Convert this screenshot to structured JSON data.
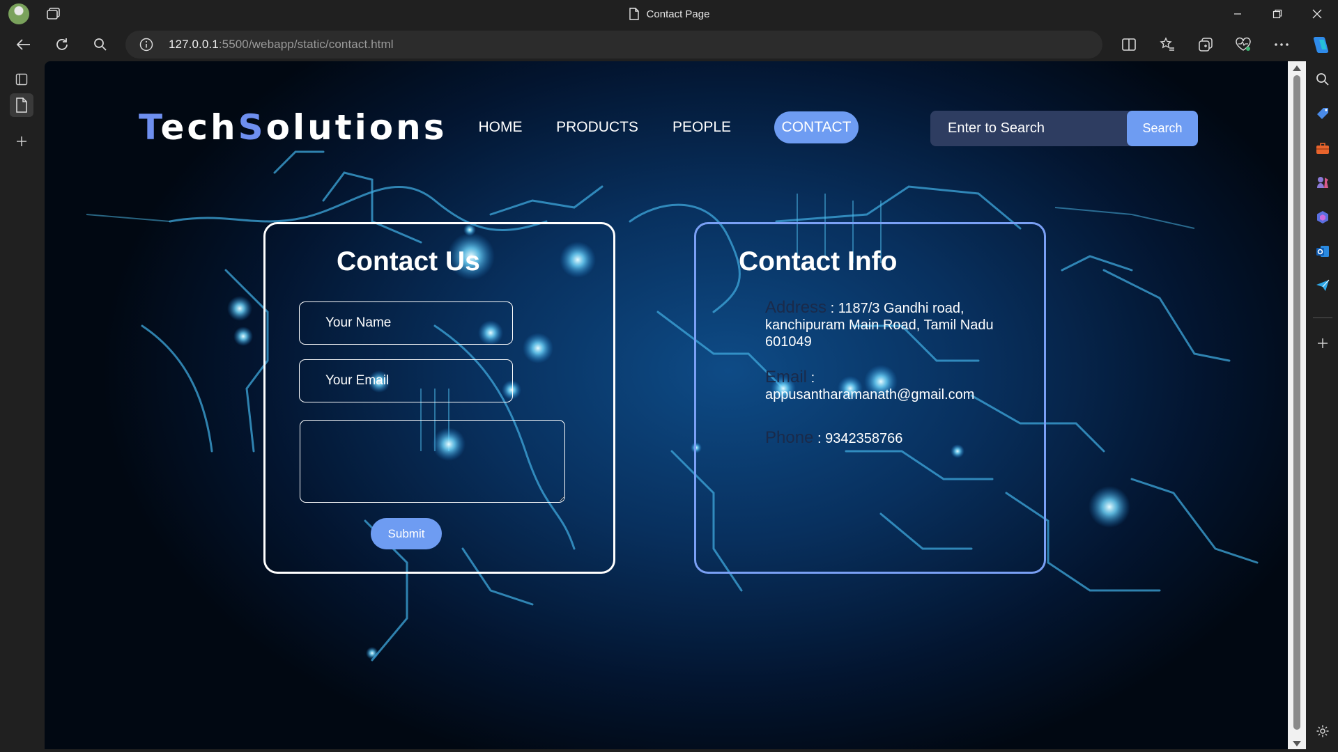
{
  "browser": {
    "tab_title": "Contact Page",
    "url_host": "127.0.0.1",
    "url_path": ":5500/webapp/static/contact.html"
  },
  "header": {
    "logo_part1": "T",
    "logo_part2": "ech",
    "logo_part3": "S",
    "logo_part4": "olutions",
    "nav": [
      {
        "label": "HOME"
      },
      {
        "label": "PRODUCTS"
      },
      {
        "label": "PEOPLE"
      },
      {
        "label": "CONTACT"
      }
    ],
    "search_placeholder": "Enter to Search",
    "search_button": "Search"
  },
  "contact_form": {
    "title": "Contact Us",
    "name_placeholder": "Your Name",
    "email_placeholder": "Your Email",
    "message_value": "",
    "submit_label": "Submit"
  },
  "contact_info": {
    "title": "Contact Info",
    "address_label": "Address",
    "address_value": ": 1187/3 Gandhi road, kanchipuram Main Road, Tamil Nadu 601049",
    "email_label": "Email",
    "email_value": ":",
    "email_address": "appusantharamanath@gmail.com",
    "phone_label": "Phone",
    "phone_value": ": 9342358766"
  },
  "colors": {
    "accent": "#6e9cf2",
    "logo_accent": "#6e8fef",
    "background_dark": "#031530",
    "info_border": "#7aa0f5"
  }
}
